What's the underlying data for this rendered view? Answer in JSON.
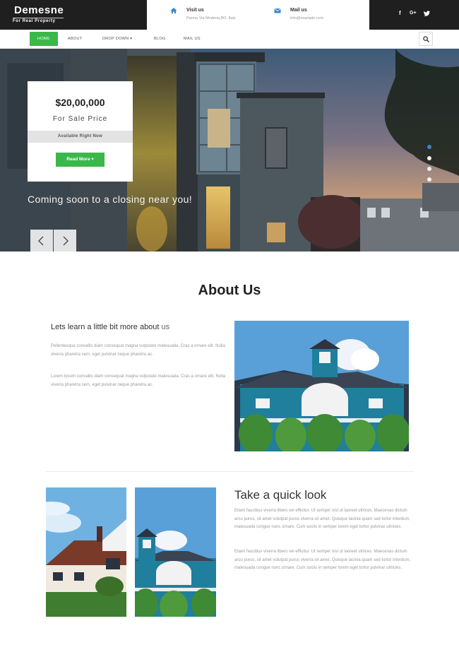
{
  "brand": {
    "name": "Demesne",
    "tagline": "For Real Property"
  },
  "contact": [
    {
      "icon": "home-icon",
      "title": "Visit us",
      "subtitle": "Parma Via Modena,BO, Italy"
    },
    {
      "icon": "envelope-icon",
      "title": "Mail us",
      "subtitle": "info@example.com"
    }
  ],
  "social": [
    "f",
    "G+",
    "twitter-icon"
  ],
  "nav": {
    "items": [
      {
        "label": "HOME",
        "active": true
      },
      {
        "label": "ABOUT"
      },
      {
        "label": "DROP DOWN ▾"
      },
      {
        "label": "BLOG"
      },
      {
        "label": "MAIL US"
      }
    ],
    "search_icon": "search-icon"
  },
  "hero": {
    "price": "$20,00,000",
    "price_label": "For Sale Price",
    "availability": "Available Right Now",
    "cta": "Read More ▾",
    "caption": "Coming soon to a closing near you!",
    "slide_count": 4,
    "active_slide": 1
  },
  "about": {
    "title": "About Us",
    "subtitle_main": "Lets learn a little bit more about",
    "subtitle_highlight": "us",
    "paragraphs": [
      "Pellentesque convallis diam consequat magna vulputate malesuada. Cras a ornare elit. Nulla viverra pharetra sem, eget pulvinar neque pharetra ac.",
      "Lorem Ipsum convallis diam consequat magna vulputate malesuada. Cras a ornare elit. Nulla viverra pharetra sem, eget pulvinar neque pharetra ac."
    ]
  },
  "quick_look": {
    "title": "Take a quick look",
    "paragraphs": [
      "Etiam faucibus viverra libero vel efficitur. Ut semper nisl ut laoreet ultrices. Maecenas dictum arcu purus, sit amet volutpat purus viverra sit amet. Quisque lacinia quam sed tortor interdum, malesuada congue nunc ornare. Cum sociis in semper lorem eget tortor pulvinar ultricies.",
      "Etiam faucibus viverra libero vel efficitur. Ut semper nisl ut laoreet ultrices. Maecenas dictum arcu purus, sit amet volutpat purus viverra sit amet. Quisque lacinia quam sed tortor interdum, malesuada congue nunc ornare. Cum sociis in semper lorem eget tortor pulvinar ultricies."
    ]
  },
  "colors": {
    "accent": "#3bb84a",
    "dark": "#1f1f1f",
    "dot_active": "#3a86c8"
  }
}
